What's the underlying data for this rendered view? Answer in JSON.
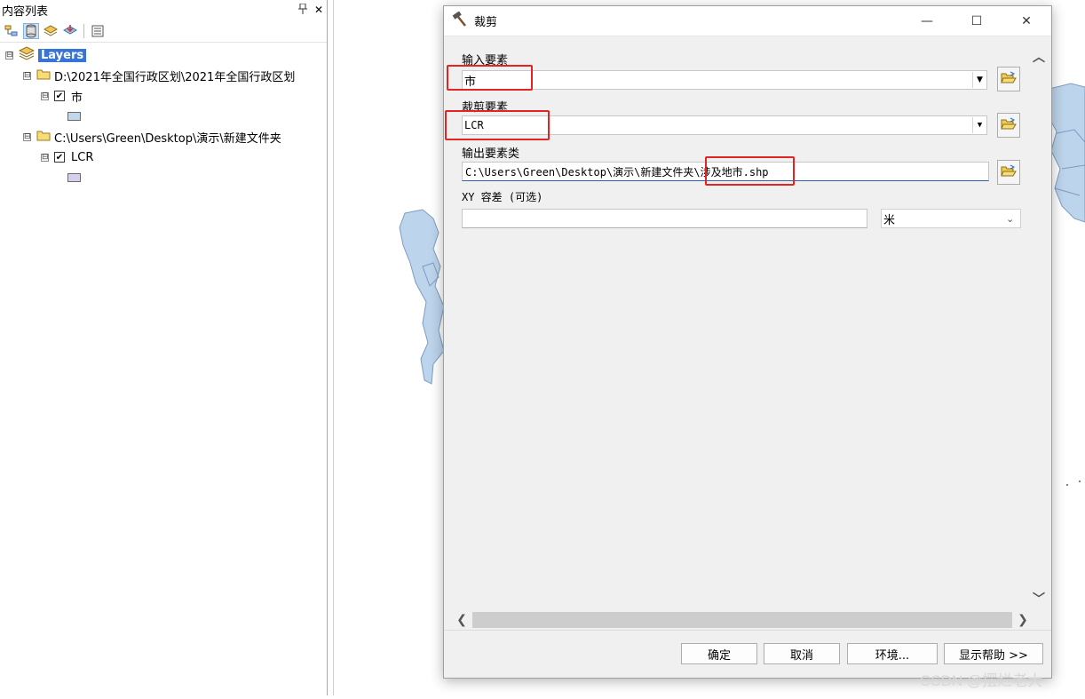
{
  "toc": {
    "title": "内容列表",
    "pin_icon": "pin-icon",
    "close_symbol": "✕",
    "root": {
      "label": "Layers",
      "expand": "⊟"
    },
    "groups": [
      {
        "path": "D:\\2021年全国行政区划\\2021年全国行政区划",
        "layer": "市",
        "checked": "✔",
        "swatch_color": "#bfd8ee"
      },
      {
        "path": "C:\\Users\\Green\\Desktop\\演示\\新建文件夹",
        "layer": "LCR",
        "checked": "✔",
        "swatch_color": "#d8cfee"
      }
    ]
  },
  "dialog": {
    "title": "裁剪",
    "win_controls": {
      "minimize": "—",
      "maximize": "☐",
      "close": "✕"
    },
    "input_features": {
      "label": "输入要素",
      "value": "市"
    },
    "clip_features": {
      "label": "裁剪要素",
      "value": "LCR"
    },
    "output": {
      "label": "输出要素类",
      "value": "C:\\Users\\Green\\Desktop\\演示\\新建文件夹\\涉及地市.shp"
    },
    "xy_tolerance": {
      "label": "XY 容差 (可选)",
      "value": "",
      "unit": "米"
    },
    "buttons": {
      "ok": "确定",
      "cancel": "取消",
      "environments": "环境...",
      "show_help": "显示帮助 >>"
    }
  },
  "watermark": "CSDN @摆烂老大",
  "colors": {
    "highlight": "#e32424",
    "layers_selected": "#3874d8",
    "map_fill": "#bcd4ec",
    "map_stroke": "#7f9cbf"
  }
}
